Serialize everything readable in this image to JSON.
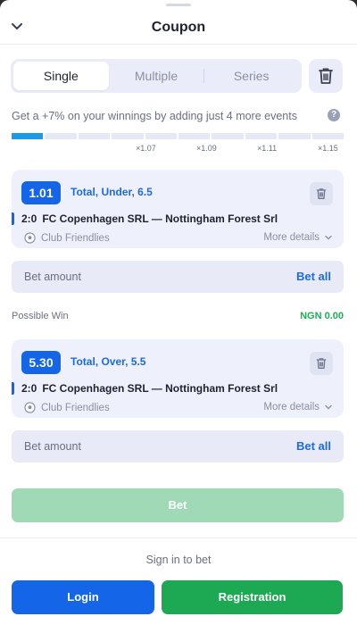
{
  "header": {
    "title": "Coupon",
    "collapse_icon": "chevron-down-icon"
  },
  "tabs": [
    {
      "label": "Single",
      "active": true
    },
    {
      "label": "Multiple",
      "active": false
    },
    {
      "label": "Series",
      "active": false
    }
  ],
  "promo": {
    "text": "Get a +7% on your winnings by adding just 4 more events",
    "progress_filled_segments": 1,
    "progress_total_segments": 10,
    "multipliers": [
      "×1.07",
      "×1.09",
      "×1.11",
      "×1.15"
    ]
  },
  "bets": [
    {
      "odd": "1.01",
      "market": "Total, Under, 6.5",
      "score": "2:0",
      "match": "FC Copenhagen SRL — Nottingham Forest Srl",
      "league": "Club Friendlies",
      "more": "More details"
    },
    {
      "odd": "5.30",
      "market": "Total, Over, 5.5",
      "score": "2:0",
      "match": "FC Copenhagen SRL — Nottingham Forest Srl",
      "league": "Club Friendlies",
      "more": "More details"
    }
  ],
  "stake": {
    "placeholder": "Bet amount",
    "bet_all": "Bet all"
  },
  "possible_win": {
    "label": "Possible Win",
    "value": "NGN 0.00"
  },
  "actions": {
    "bet": "Bet",
    "sign_in_prompt": "Sign in to bet",
    "login": "Login",
    "registration": "Registration"
  },
  "colors": {
    "accent_blue": "#1565e8",
    "green": "#1da854",
    "possible_win_green": "#1bb157",
    "bet_disabled": "#9fd9b6"
  }
}
